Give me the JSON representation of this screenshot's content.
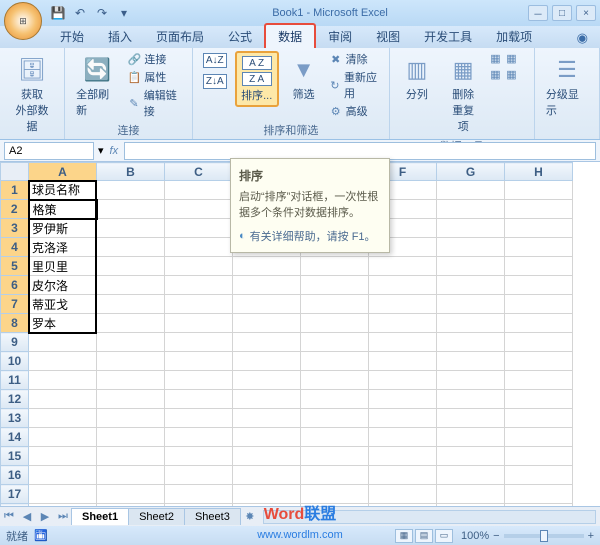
{
  "title": "Book1 - Microsoft Excel",
  "qat": {
    "save": "💾",
    "undo": "↶",
    "redo": "↷"
  },
  "tabs": [
    "开始",
    "插入",
    "页面布局",
    "公式",
    "数据",
    "审阅",
    "视图",
    "开发工具",
    "加载项"
  ],
  "active_tab_index": 4,
  "ribbon": {
    "group1": {
      "label": "连接",
      "big": "获取\n外部数据",
      "refresh": "全部刷新",
      "items": [
        "连接",
        "属性",
        "编辑链接"
      ]
    },
    "group2": {
      "label": "排序和筛选",
      "az": "A→Z",
      "za": "Z→A",
      "sort": "排序...",
      "filter": "筛选",
      "items": [
        "清除",
        "重新应用",
        "高级"
      ]
    },
    "group3": {
      "label": "数据工具",
      "split": "分列",
      "dedup": "删除\n重复项",
      "items": [
        "▦",
        "▦",
        "▦",
        "▦"
      ]
    },
    "group4": {
      "label": "",
      "outline": "分级显示"
    }
  },
  "name_box": "A2",
  "fx_label": "fx",
  "tooltip": {
    "title": "排序",
    "body": "启动“排序”对话框，一次性根据多个条件对数据排序。",
    "hint": "有关详细帮助，请按 F1。"
  },
  "columns": [
    "A",
    "B",
    "C",
    "D",
    "E",
    "F",
    "G",
    "H"
  ],
  "rows": 18,
  "sel_rows": [
    2,
    3,
    4,
    5,
    6,
    7,
    8
  ],
  "data": {
    "A1": "球员名称",
    "A2": "格策",
    "A3": "罗伊斯",
    "A4": "克洛泽",
    "A5": "里贝里",
    "A6": "皮尔洛",
    "A7": "蒂亚戈",
    "A8": "罗本"
  },
  "sheets": [
    "Sheet1",
    "Sheet2",
    "Sheet3"
  ],
  "active_sheet": 0,
  "status": "就绪",
  "status_icon": "🛅",
  "zoom": "100%",
  "watermark": {
    "w1": "Word",
    "w2": "联盟",
    "url": "www.wordlm.com"
  }
}
